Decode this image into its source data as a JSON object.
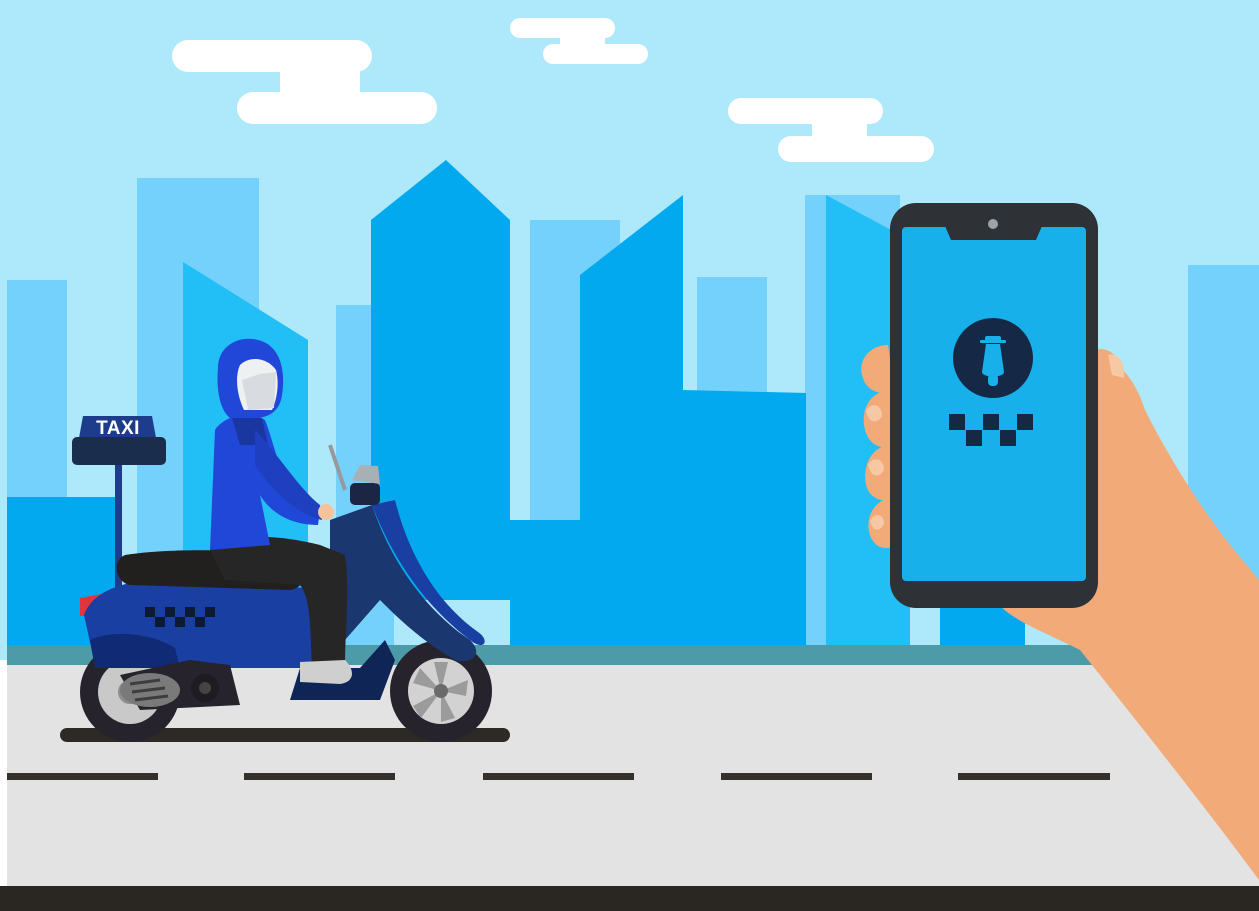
{
  "taxi_sign": {
    "label": "TAXI"
  },
  "icons": {
    "phone_app_icon": "scooter-icon",
    "checker_pattern": "checkered-taxi-icon"
  },
  "colors": {
    "sky": "#aee8fb",
    "buildings_light": "#74d1fb",
    "buildings_mid": "#21bff5",
    "buildings_deep": "#03a9ef",
    "road": "#e3e3e3",
    "road_dark": "#2a2723",
    "scooter_blue": "#1a3fa3",
    "rider_blue": "#2147d8",
    "phone_body": "#2e3237",
    "phone_screen": "#18b0ea",
    "hand": "#f2aa78"
  }
}
